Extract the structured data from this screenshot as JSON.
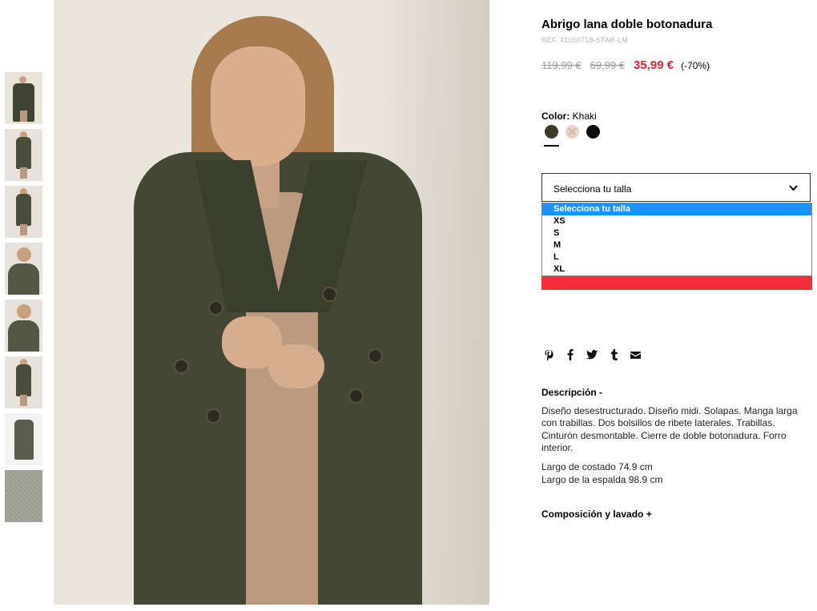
{
  "product": {
    "title": "Abrigo lana doble botonadura",
    "ref": "REF. 41050718-STAR-LM",
    "price_original": "119,99 €",
    "price_previous": "69,99 €",
    "price_sale": "35,99 €",
    "discount": "(-70%)"
  },
  "color": {
    "label": "Color:",
    "value": "Khaki",
    "swatches": [
      {
        "name": "khaki",
        "hex": "#3d3c2a",
        "selected": true,
        "available": true
      },
      {
        "name": "beige",
        "hex": "#e6d2c3",
        "selected": false,
        "available": false
      },
      {
        "name": "black",
        "hex": "#0d0d10",
        "selected": false,
        "available": true
      }
    ]
  },
  "size": {
    "placeholder": "Selecciona tu talla",
    "options": [
      "Selecciona tu talla",
      "XS",
      "S",
      "M",
      "L",
      "XL"
    ],
    "highlighted": "Selecciona tu talla"
  },
  "share_icons": [
    "pinterest-icon",
    "facebook-icon",
    "twitter-icon",
    "tumblr-icon",
    "mail-icon"
  ],
  "description": {
    "heading": "Descripción -",
    "text": "Diseño desestructurado. Diseño midi. Solapas. Manga larga con trabillas. Dos bolsillos de ribete laterales. Trabillas. Cinturón desmontable. Cierre de doble botonadura. Forro interior.",
    "measure_1": "Largo de costado 74.9 cm",
    "measure_2": "Largo de la espalda 98.9 cm"
  },
  "composition": {
    "heading": "Composición y lavado +"
  },
  "colors": {
    "sale_red": "#e42037",
    "button_red": "#f22d3c",
    "dropdown_highlight": "#1e90ff"
  }
}
